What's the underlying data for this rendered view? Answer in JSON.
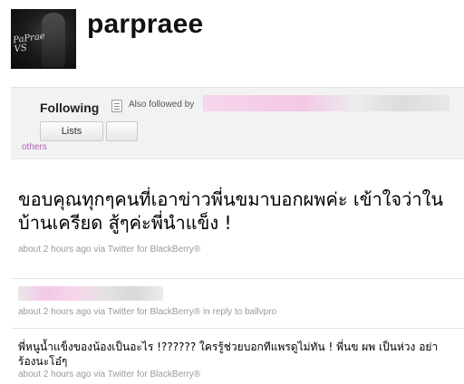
{
  "profile": {
    "username": "parpraee",
    "avatar_text": "PaPrae\nVS"
  },
  "panel": {
    "following_label": "Following",
    "also_followed_label": "Also followed by",
    "lists_button": "Lists",
    "others_link": "others"
  },
  "tweets": [
    {
      "text": "ขอบคุณทุกๆคนที่เอาข่าวพี่นขมาบอกผพค่ะ เข้าใจว่าในบ้านเครียด สู้ๆค่ะพี่นำแข็ง !",
      "meta": "about 2 hours ago via Twitter for BlackBerry®"
    },
    {
      "text": "",
      "meta": "about 2 hours ago via Twitter for BlackBerry® in reply to ballvpro"
    },
    {
      "text": "พี่หนูน้ำแข็งของน้องเป็นอะไร !?????? ใครรู้ช่วยบอกทีแพรดูไม่ทัน ! พี่นข ผพ เป็นห่วง อย่าร้องนะโอ๋ๆ",
      "meta": "about 2 hours ago via Twitter for BlackBerry®"
    }
  ],
  "colors": {
    "link": "#b35fb3",
    "meta": "#9a9a9a",
    "panel_bg": "#f2f2f2"
  }
}
